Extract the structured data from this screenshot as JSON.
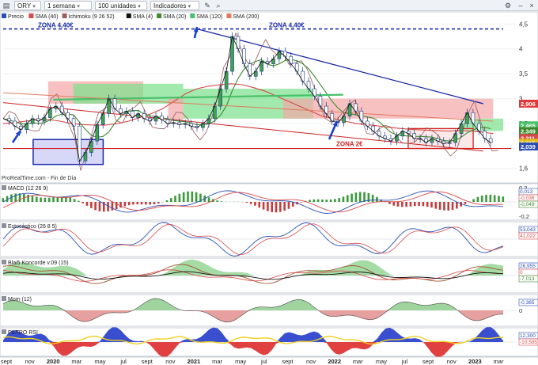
{
  "toolbar": {
    "symbol": "ORY",
    "period": "1 semana",
    "units": "100 unidades",
    "indicators": "Indicadores"
  },
  "main_legend": [
    {
      "label": "Precio",
      "color": "#2b4fb5"
    },
    {
      "label": "SMA (40)",
      "color": "#d94848"
    },
    {
      "label": "Ichimoku (9 26 52)",
      "color": "#9a5c5c"
    },
    {
      "label": "SMA (4)",
      "color": "#111111"
    },
    {
      "label": "SMA (20)",
      "color": "#3c8a2e"
    },
    {
      "label": "SMA (120)",
      "color": "#49c06a"
    },
    {
      "label": "SMA (200)",
      "color": "#e07a5f"
    }
  ],
  "source": "ProRealTime.com - Fin de Día",
  "annotations": {
    "zona_top": "ZONA 4,40€",
    "zona_bottom": "ZONA 2€"
  },
  "price_badges": [
    {
      "text": "2,906",
      "color": "#e03a3a",
      "value": 2.9
    },
    {
      "text": "2,465",
      "color": "#49c06a",
      "value": 2.465
    },
    {
      "text": "2,349",
      "color": "#3c8a2e",
      "value": 2.35
    },
    {
      "text": "2,211",
      "color": "#d94848",
      "value": 2.21
    },
    {
      "text": "2,115",
      "color": "#e0c020",
      "value": 2.115
    },
    {
      "text": "2,039",
      "color": "#2b4fb5",
      "value": 2.04
    }
  ],
  "panels": [
    {
      "label": "MACD (12 26 9)",
      "values": [
        "0,013",
        "-0,036",
        "-0,049"
      ],
      "ticks": [
        "0,2",
        "0",
        "-0,2"
      ]
    },
    {
      "label": "Estocástico (26 8 5)",
      "values": [
        "53,043",
        "41,022"
      ],
      "ticks": []
    },
    {
      "label": "Blai5 Koncorde v.09 (15)",
      "values": [
        "26,955",
        "0",
        "-7,013"
      ],
      "ticks": []
    },
    {
      "label": "Mom (12)",
      "values": [
        "-0,365"
      ],
      "ticks": [
        "0"
      ]
    },
    {
      "label": "FILTRO RSI",
      "values": [
        "12,300",
        "-10,585"
      ],
      "ticks": []
    }
  ],
  "chart_data": {
    "type": "line",
    "ylim": [
      1.5,
      4.6
    ],
    "yticks": [
      1.6,
      2,
      2.5,
      3,
      3.5,
      4,
      4.5
    ],
    "ytick_labels": [
      "1,6",
      "2",
      "2,5",
      "3",
      "3,5",
      "4",
      "4,5"
    ],
    "xtick_labels": [
      "sept",
      "nov",
      "2020",
      "mar",
      "may",
      "jul",
      "sept",
      "nov",
      "2021",
      "mar",
      "may",
      "jul",
      "sept",
      "nov",
      "2022",
      "mar",
      "may",
      "jul",
      "sept",
      "nov",
      "2023",
      "mar"
    ],
    "price_series": [
      2.6,
      2.55,
      2.45,
      2.38,
      2.5,
      2.6,
      2.55,
      2.62,
      2.8,
      2.85,
      2.72,
      2.6,
      2.45,
      1.75,
      1.92,
      2.15,
      2.48,
      2.7,
      3.0,
      2.8,
      2.7,
      2.75,
      2.62,
      2.7,
      2.6,
      2.55,
      2.65,
      2.58,
      2.5,
      2.52,
      2.48,
      2.5,
      2.45,
      2.42,
      2.5,
      2.6,
      2.85,
      3.2,
      3.55,
      4.25,
      4.0,
      3.7,
      3.45,
      3.55,
      3.75,
      3.7,
      3.8,
      3.95,
      3.85,
      3.7,
      3.55,
      3.35,
      3.2,
      3.05,
      2.85,
      2.7,
      2.55,
      2.52,
      2.65,
      2.9,
      2.75,
      2.55,
      2.45,
      2.35,
      2.25,
      2.2,
      2.15,
      2.25,
      2.35,
      2.3,
      2.2,
      2.2,
      2.12,
      2.2,
      2.15,
      2.1,
      2.12,
      2.3,
      2.5,
      2.72,
      2.5,
      2.35,
      2.2,
      2.12
    ],
    "sma40": [
      2.5,
      2.52,
      2.55,
      2.58,
      2.58,
      2.55,
      2.5,
      2.48,
      2.47,
      2.47,
      2.5,
      2.55,
      2.62,
      2.7,
      2.8,
      2.95,
      3.1,
      3.2,
      3.25,
      3.28,
      3.3,
      3.28,
      3.22,
      3.15,
      3.05,
      2.95,
      2.85,
      2.75,
      2.65,
      2.6,
      2.55,
      2.5,
      2.48,
      2.45,
      2.42,
      2.4,
      2.38,
      2.37,
      2.36,
      2.35,
      2.36,
      2.35,
      2.33,
      2.3
    ],
    "ichimoku_cloud": {
      "tenkan_color": "#9a5c5c",
      "bull_color": "#7be08a",
      "bear_color": "#f3a7a7"
    },
    "zona_top_value": 4.4,
    "zona_bottom_value": 2.0,
    "resistance_line": {
      "from": [
        0.388,
        4.4
      ],
      "to": [
        0.96,
        2.9
      ]
    },
    "support_line": {
      "from": [
        0.0,
        2.92
      ],
      "to": [
        0.96,
        1.95
      ]
    },
    "box1": {
      "x": [
        0.06,
        0.2
      ],
      "y": [
        1.68,
        2.18
      ]
    },
    "box2": {
      "x": [
        0.81,
        0.94
      ],
      "y": [
        2.0,
        2.4
      ]
    }
  }
}
